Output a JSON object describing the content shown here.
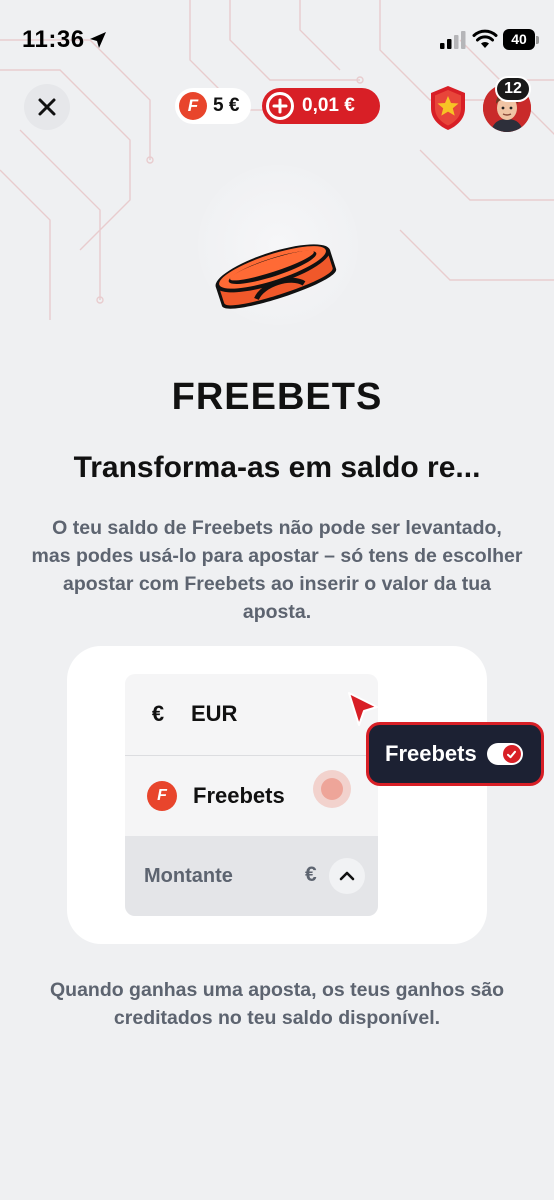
{
  "status_bar": {
    "time": "11:36",
    "battery_level": "40"
  },
  "header": {
    "freebets_balance": "5 €",
    "freebets_icon_letter": "F",
    "balance": "0,01 €",
    "notifications_count": "12"
  },
  "content": {
    "title": "FREEBETS",
    "subtitle": "Transforma-as em saldo re...",
    "description": "O teu saldo de Freebets não pode ser levantado, mas podes usá-lo para apostar – só tens de escolher apostar com Freebets ao inserir o valor da tua aposta.",
    "footer": "Quando ganhas uma aposta, os teus ganhos são creditados no teu saldo disponível."
  },
  "demo": {
    "eur_symbol": "€",
    "eur_label": "EUR",
    "freebets_label": "Freebets",
    "amount_label": "Montante",
    "amount_currency": "€",
    "toggle_label": "Freebets",
    "toggle_on": true
  },
  "colors": {
    "accent_red": "#d81f26",
    "freebets_orange": "#e8452c",
    "dark_navy": "#1c2133",
    "muted_text": "#5d6470",
    "background": "#eff0f2"
  }
}
